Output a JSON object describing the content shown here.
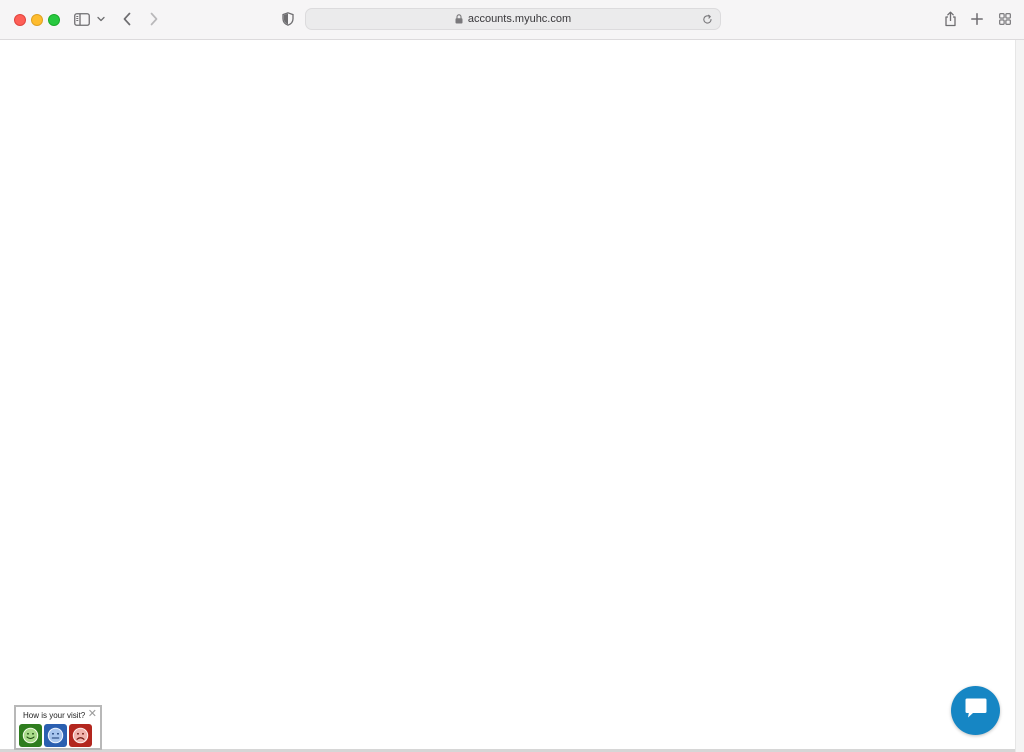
{
  "browser": {
    "url": "accounts.myuhc.com",
    "icons": {
      "sidebar": "sidebar-icon",
      "sidebar_menu": "chevron-down-icon",
      "back": "chevron-left-icon",
      "forward": "chevron-right-icon",
      "privacy": "shield-icon",
      "lock": "lock-icon",
      "reload": "reload-icon",
      "share": "share-icon",
      "new_tab": "plus-icon",
      "tab_overview": "grid-icon"
    }
  },
  "feedback": {
    "question": "How is your visit?",
    "close_glyph": "✕",
    "options": [
      {
        "icon": "smile-face-icon",
        "color": "#2e7d1e"
      },
      {
        "icon": "neutral-face-icon",
        "color": "#2a5fb0"
      },
      {
        "icon": "frown-face-icon",
        "color": "#b3261e"
      }
    ]
  },
  "chat": {
    "icon": "chat-bubble-icon",
    "color": "#1686c4"
  },
  "colors": {
    "toolbar_bg": "#f6f5f6",
    "close": "#fe5f57",
    "minimize": "#febc2e",
    "maximize": "#28c840"
  }
}
